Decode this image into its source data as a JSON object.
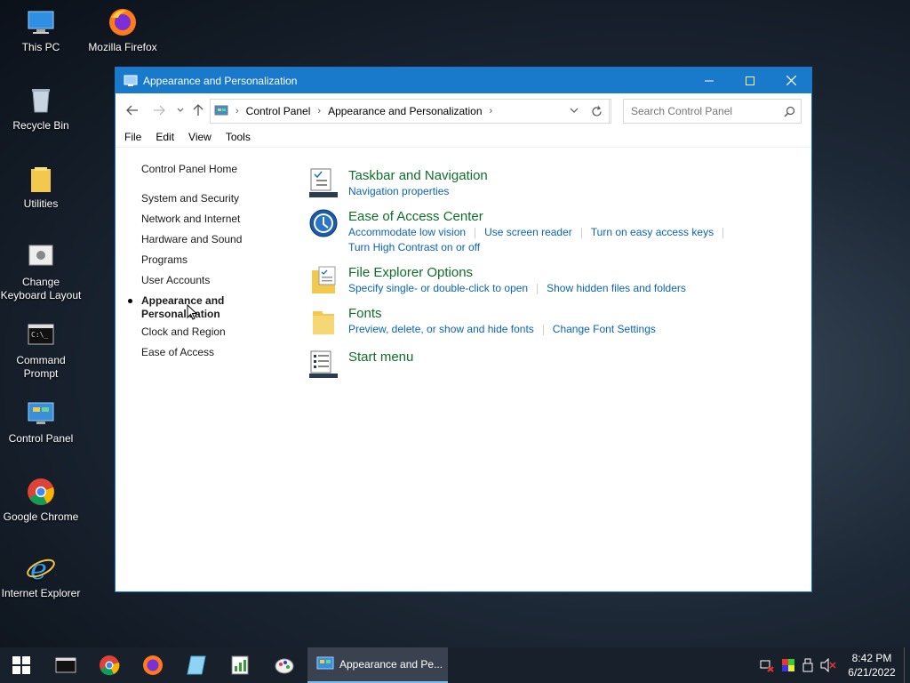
{
  "desktop": {
    "icons": [
      {
        "label": "This PC"
      },
      {
        "label": "Mozilla Firefox"
      },
      {
        "label": "Recycle Bin"
      },
      {
        "label": "Utilities"
      },
      {
        "label": "Change Keyboard Layout"
      },
      {
        "label": "Command Prompt"
      },
      {
        "label": "Control Panel"
      },
      {
        "label": "Google Chrome"
      },
      {
        "label": "Internet Explorer"
      }
    ]
  },
  "window": {
    "title": "Appearance and Personalization",
    "breadcrumb": [
      "Control Panel",
      "Appearance and Personalization"
    ],
    "search_placeholder": "Search Control Panel",
    "menu": [
      "File",
      "Edit",
      "View",
      "Tools"
    ]
  },
  "leftnav": {
    "home": "Control Panel Home",
    "items": [
      "System and Security",
      "Network and Internet",
      "Hardware and Sound",
      "Programs",
      "User Accounts",
      "Appearance and Personalization",
      "Clock and Region",
      "Ease of Access"
    ]
  },
  "categories": [
    {
      "title": "Taskbar and Navigation",
      "links": [
        "Navigation properties"
      ]
    },
    {
      "title": "Ease of Access Center",
      "links": [
        "Accommodate low vision",
        "Use screen reader",
        "Turn on easy access keys",
        "Turn High Contrast on or off"
      ]
    },
    {
      "title": "File Explorer Options",
      "links": [
        "Specify single- or double-click to open",
        "Show hidden files and folders"
      ]
    },
    {
      "title": "Fonts",
      "links": [
        "Preview, delete, or show and hide fonts",
        "Change Font Settings"
      ]
    },
    {
      "title": "Start menu",
      "links": []
    }
  ],
  "taskbar": {
    "active_label": "Appearance and Pe...",
    "time": "8:42 PM",
    "date": "6/21/2022"
  },
  "colors": {
    "accent": "#1979ca",
    "category_title": "#0f6e2a",
    "link": "#0b63b6"
  }
}
